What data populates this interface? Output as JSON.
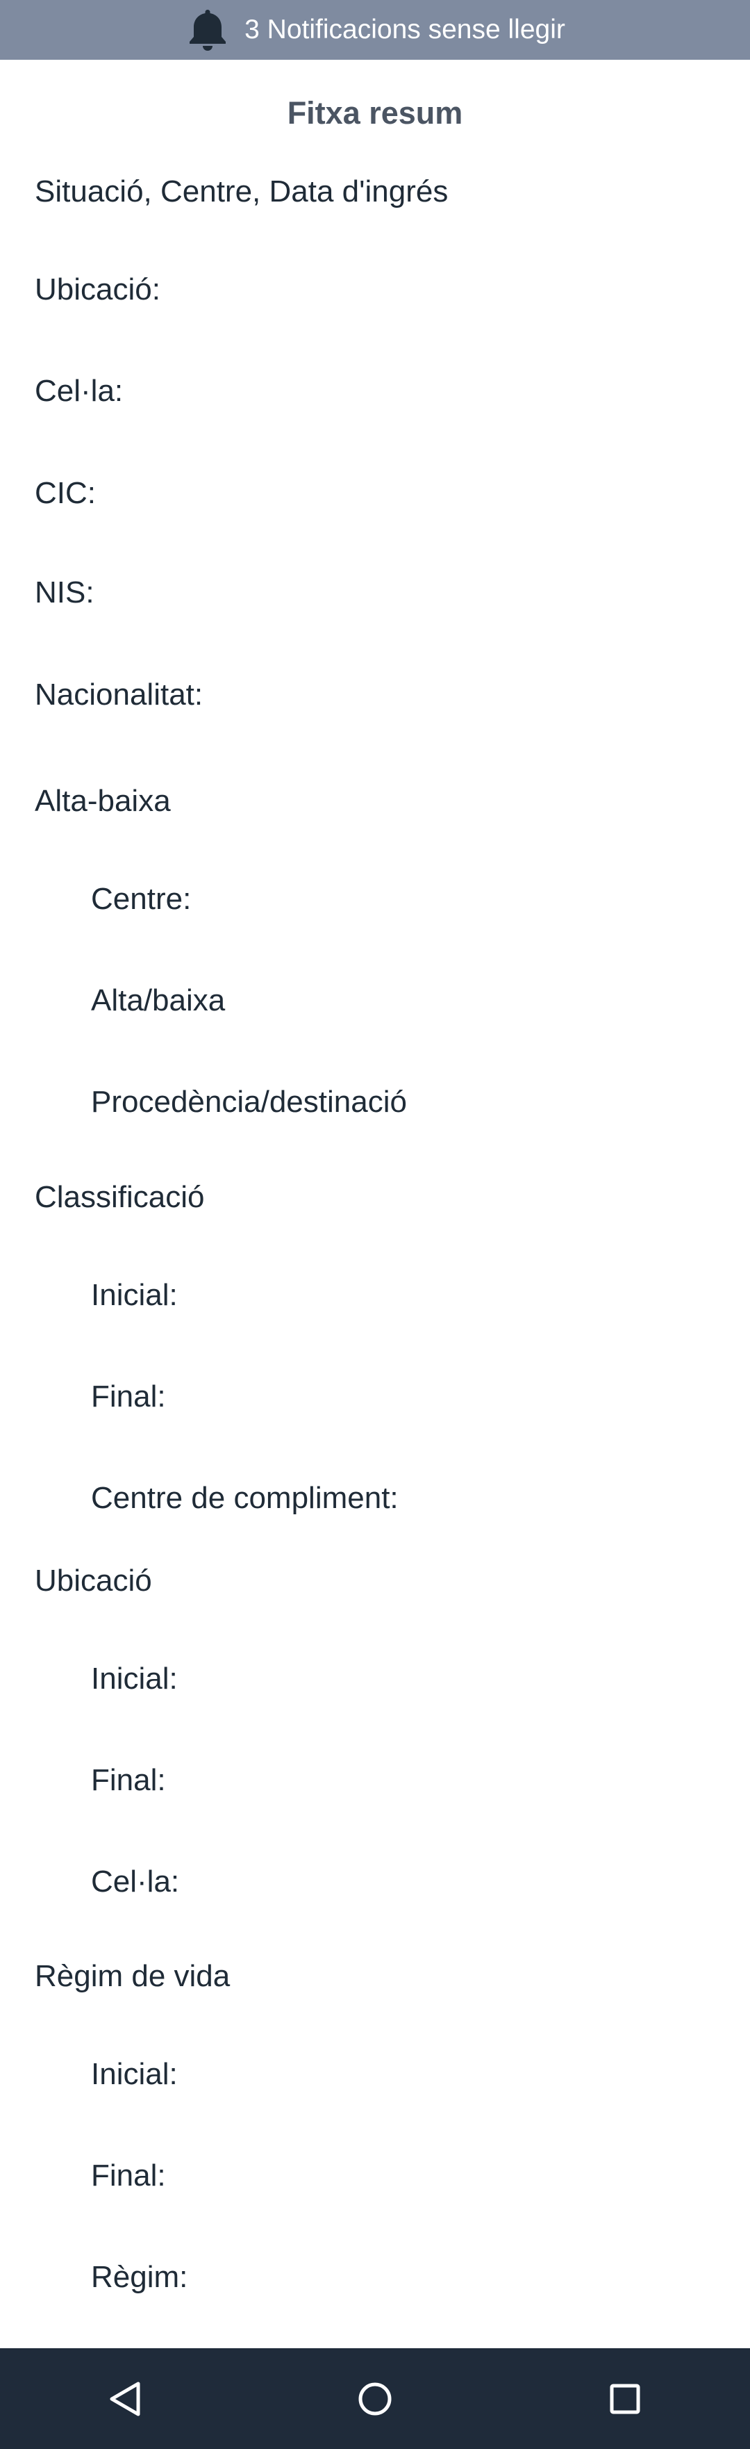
{
  "notification_bar": {
    "icon": "bell-icon",
    "text": "3 Notificacions sense llegir"
  },
  "title": "Fitxa resum",
  "rows": {
    "situacio": "Situació, Centre, Data d'ingrés",
    "ubicacio": "Ubicació:",
    "cella": "Cel·la:",
    "cic": "CIC:",
    "nis": "NIS:",
    "nacionalitat": "Nacionalitat:"
  },
  "sections": {
    "alta_baixa": {
      "heading": "Alta-baixa",
      "items": [
        "Centre:",
        "Alta/baixa",
        "Procedència/destinació"
      ]
    },
    "classificacio": {
      "heading": "Classificació",
      "items": [
        "Inicial:",
        "Final:",
        "Centre de compliment:"
      ]
    },
    "ubicacio": {
      "heading": "Ubicació",
      "items": [
        "Inicial:",
        "Final:",
        "Cel·la:"
      ]
    },
    "regim_de_vida": {
      "heading": "Règim de vida",
      "items": [
        "Inicial:",
        "Final:",
        "Règim:"
      ]
    }
  },
  "navigation": {
    "back": "back-triangle-icon",
    "home": "home-circle-icon",
    "recents": "recents-square-icon"
  },
  "colors": {
    "notification_bg": "#7f8ba0",
    "nav_bg": "#1f2b3a",
    "text": "#1f2b37",
    "title": "#4b5563"
  }
}
